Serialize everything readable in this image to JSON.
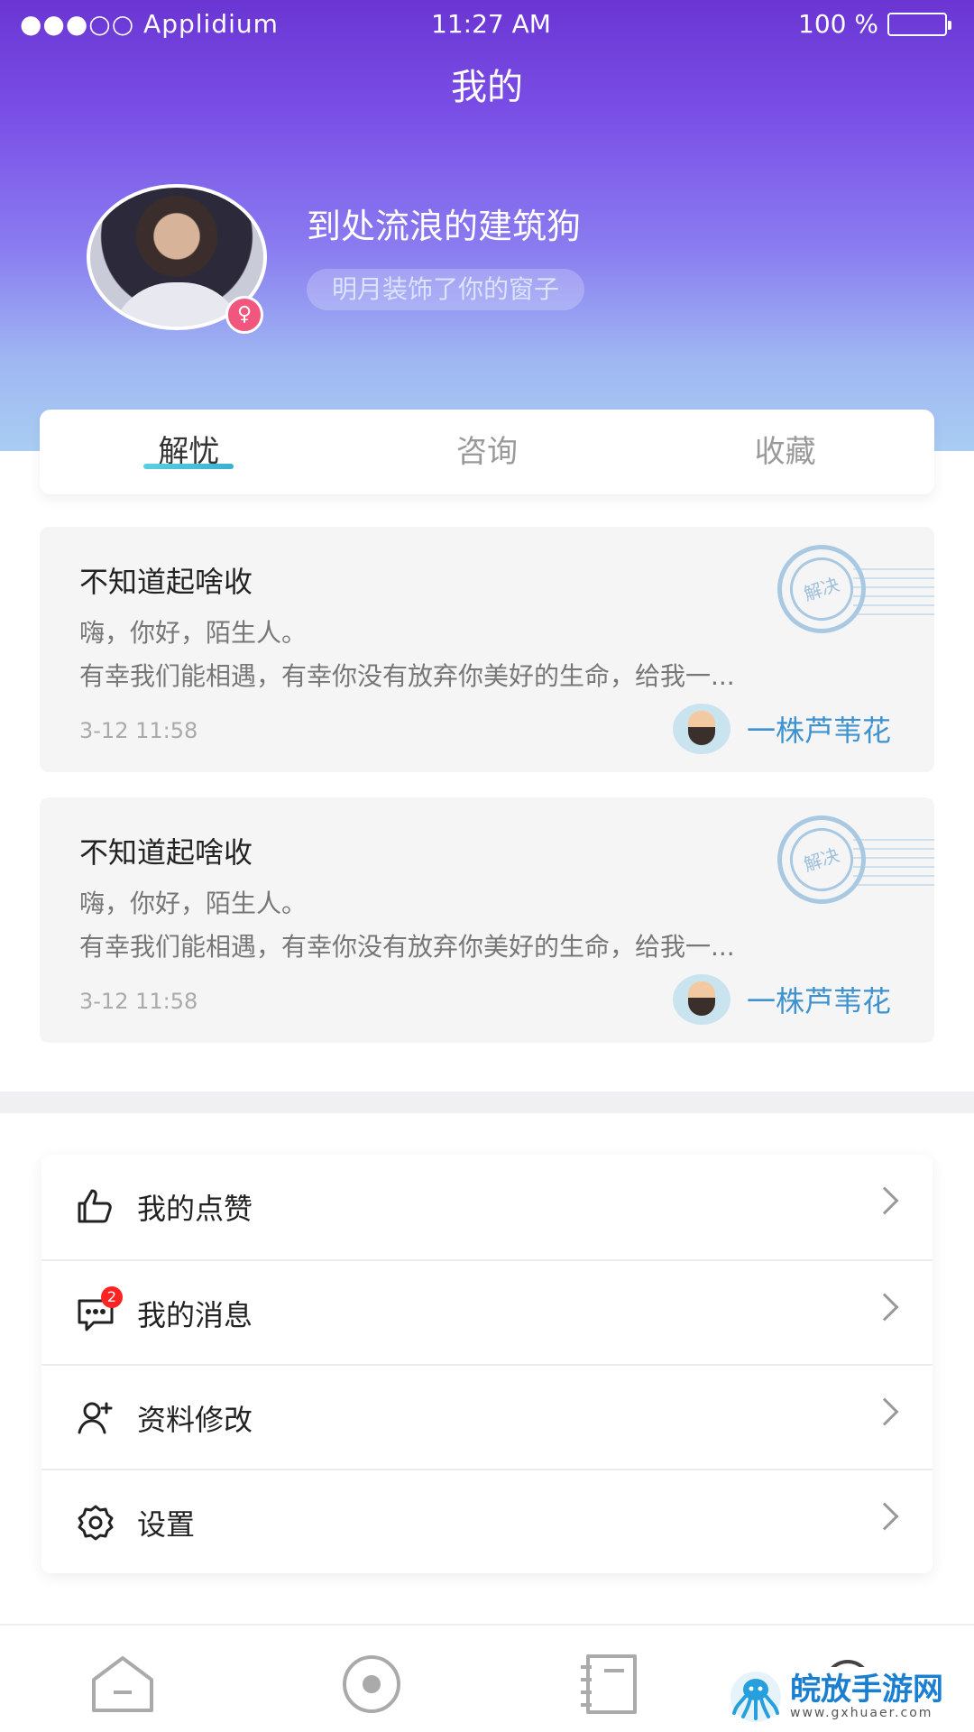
{
  "status_bar": {
    "carrier": "●●●○○ Applidium",
    "time": "11:27 AM",
    "battery": "100 %"
  },
  "header": {
    "title": "我的"
  },
  "profile": {
    "username": "到处流浪的建筑狗",
    "motto": "明月装饰了你的窗子",
    "gender_symbol": "♀"
  },
  "tabs": [
    {
      "label": "解忧"
    },
    {
      "label": "咨询"
    },
    {
      "label": "收藏"
    }
  ],
  "posts": [
    {
      "title": "不知道起啥收",
      "line1": "嗨，你好，陌生人。",
      "line2": "有幸我们能相遇，有幸你没有放弃你美好的生命，给我一...",
      "time": "3-12 11:58",
      "author": "一株芦苇花",
      "stamp": "解决"
    },
    {
      "title": "不知道起啥收",
      "line1": "嗨，你好，陌生人。",
      "line2": "有幸我们能相遇，有幸你没有放弃你美好的生命，给我一...",
      "time": "3-12 11:58",
      "author": "一株芦苇花",
      "stamp": "解决"
    }
  ],
  "menu": [
    {
      "label": "我的点赞",
      "icon": "thumbs-up-icon"
    },
    {
      "label": "我的消息",
      "icon": "message-icon",
      "badge": "2"
    },
    {
      "label": "资料修改",
      "icon": "user-add-icon"
    },
    {
      "label": "设置",
      "icon": "gear-icon"
    }
  ],
  "watermark": {
    "title": "皖放手游网",
    "url": "www.gxhuaer.com"
  },
  "colors": {
    "accent": "#3d92cf",
    "header_top": "#6a35d3",
    "header_bottom": "#a9cdf2",
    "badge": "#ff2222"
  }
}
